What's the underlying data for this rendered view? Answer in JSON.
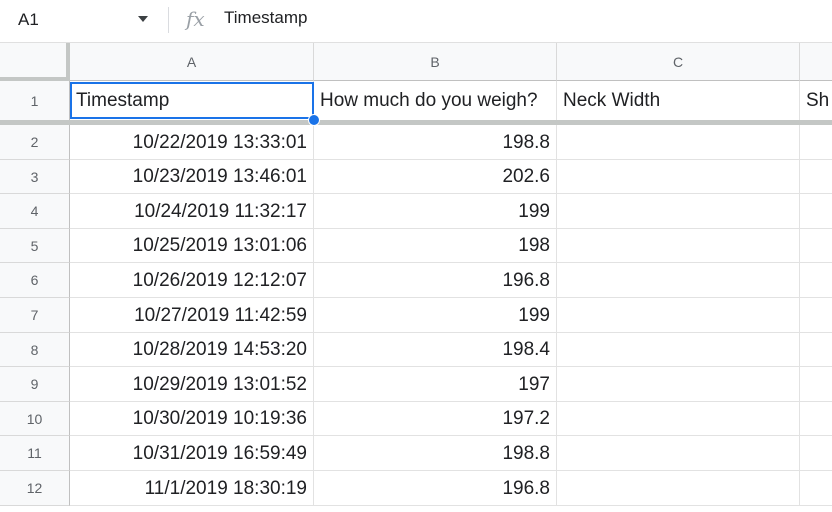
{
  "formula_bar": {
    "name_box": "A1",
    "fx_label": "fx",
    "formula": "Timestamp"
  },
  "columns": [
    "A",
    "B",
    "C"
  ],
  "header_row": {
    "row_number": "1",
    "cells": [
      "Timestamp",
      "How much do you weigh?",
      "Neck Width",
      "Sh"
    ]
  },
  "rows": [
    {
      "n": "2",
      "timestamp": "10/22/2019 13:33:01",
      "weight": "198.8"
    },
    {
      "n": "3",
      "timestamp": "10/23/2019 13:46:01",
      "weight": "202.6"
    },
    {
      "n": "4",
      "timestamp": "10/24/2019 11:32:17",
      "weight": "199"
    },
    {
      "n": "5",
      "timestamp": "10/25/2019 13:01:06",
      "weight": "198"
    },
    {
      "n": "6",
      "timestamp": "10/26/2019 12:12:07",
      "weight": "196.8"
    },
    {
      "n": "7",
      "timestamp": "10/27/2019 11:42:59",
      "weight": "199"
    },
    {
      "n": "8",
      "timestamp": "10/28/2019 14:53:20",
      "weight": "198.4"
    },
    {
      "n": "9",
      "timestamp": "10/29/2019 13:01:52",
      "weight": "197"
    },
    {
      "n": "10",
      "timestamp": "10/30/2019 10:19:36",
      "weight": "197.2"
    },
    {
      "n": "11",
      "timestamp": "10/31/2019 16:59:49",
      "weight": "198.8"
    },
    {
      "n": "12",
      "timestamp": "11/1/2019 18:30:19",
      "weight": "196.8"
    }
  ],
  "colors": {
    "selection": "#1a73e8",
    "header_bg": "#f8f9fa",
    "gridline": "#e2e2e2"
  }
}
